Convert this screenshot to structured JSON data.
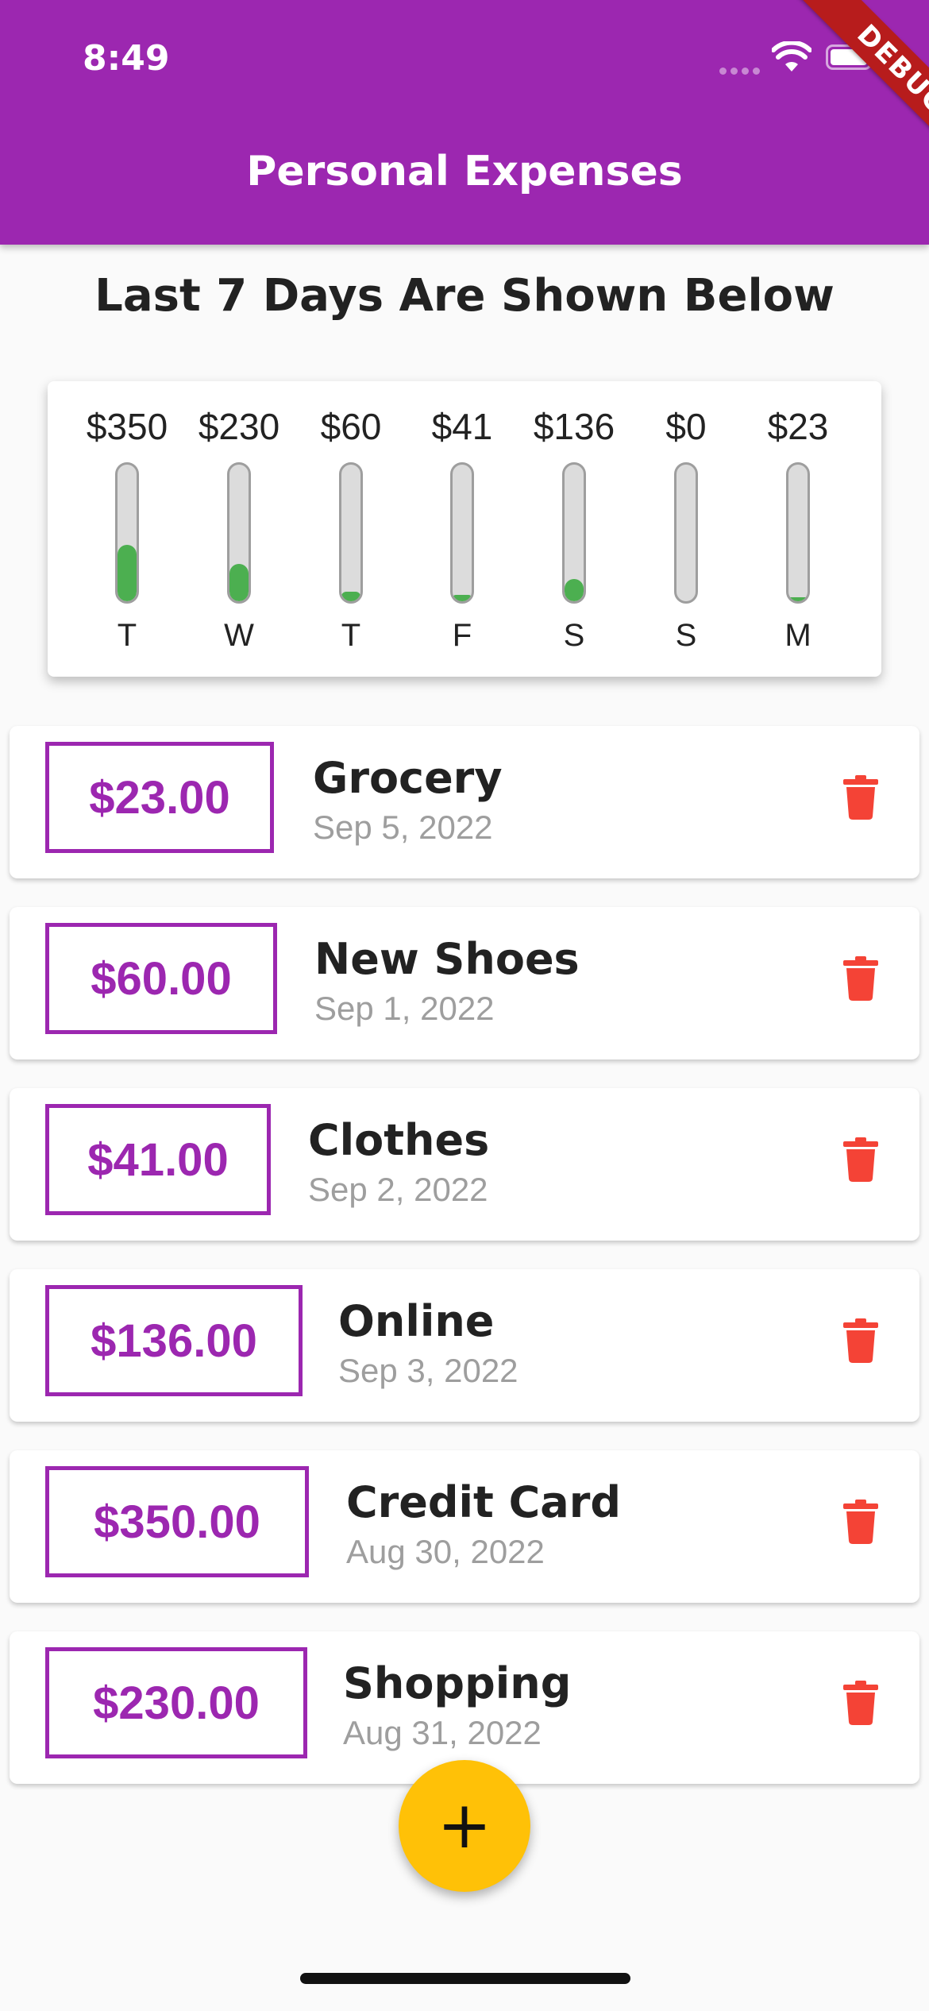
{
  "status_bar": {
    "time": "8:49"
  },
  "debug_banner": "DEBUG",
  "app_bar": {
    "title": "Personal Expenses"
  },
  "header": {
    "title": "Last 7 Days Are Shown Below"
  },
  "chart": {
    "bars": [
      {
        "amount": "$350",
        "day": "T",
        "fraction": 0.414
      },
      {
        "amount": "$230",
        "day": "W",
        "fraction": 0.272
      },
      {
        "amount": "$60",
        "day": "T",
        "fraction": 0.071
      },
      {
        "amount": "$41",
        "day": "F",
        "fraction": 0.049
      },
      {
        "amount": "$136",
        "day": "S",
        "fraction": 0.161
      },
      {
        "amount": "$0",
        "day": "S",
        "fraction": 0.0
      },
      {
        "amount": "$23",
        "day": "M",
        "fraction": 0.027
      }
    ]
  },
  "transactions": [
    {
      "amount": "$23.00",
      "title": "Grocery",
      "date": "Sep 5, 2022"
    },
    {
      "amount": "$60.00",
      "title": "New Shoes",
      "date": "Sep 1, 2022"
    },
    {
      "amount": "$41.00",
      "title": "Clothes",
      "date": "Sep 2, 2022"
    },
    {
      "amount": "$136.00",
      "title": "Online",
      "date": "Sep 3, 2022"
    },
    {
      "amount": "$350.00",
      "title": "Credit Card",
      "date": "Aug 30, 2022"
    },
    {
      "amount": "$230.00",
      "title": "Shopping",
      "date": "Aug 31, 2022"
    }
  ],
  "fab": {
    "label": "+"
  },
  "colors": {
    "primary": "#9c27b0",
    "accent": "#ffc107",
    "bar_fill": "#4caf50",
    "delete": "#f44336"
  },
  "icons": {
    "status": [
      "wifi-icon",
      "battery-icon"
    ],
    "delete": "trash-icon",
    "fab": "plus-icon"
  }
}
